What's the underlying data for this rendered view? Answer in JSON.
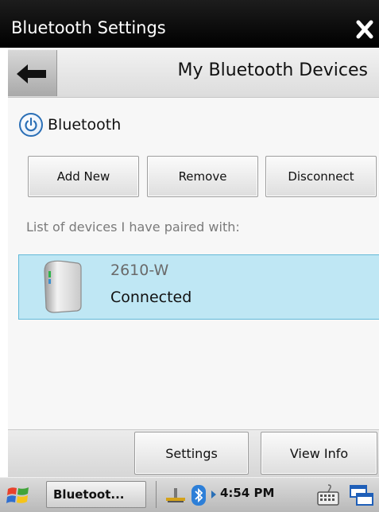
{
  "window": {
    "title": "Bluetooth Settings"
  },
  "header": {
    "title": "My Bluetooth Devices"
  },
  "bluetooth_toggle": {
    "label": "Bluetooth"
  },
  "actions": {
    "add_new": "Add New",
    "remove": "Remove",
    "disconnect": "Disconnect"
  },
  "device_list": {
    "caption": "List of devices I have paired with:",
    "items": [
      {
        "name": "2610-W",
        "status": "Connected"
      }
    ]
  },
  "bottom_buttons": {
    "settings": "Settings",
    "view_info": "View Info"
  },
  "taskbar": {
    "task_label": "Bluetoot...",
    "clock": "4:54 PM"
  },
  "colors": {
    "selection_bg": "#bfe7f4",
    "selection_border": "#63b9d8",
    "accent_blue": "#2a6fb6"
  }
}
